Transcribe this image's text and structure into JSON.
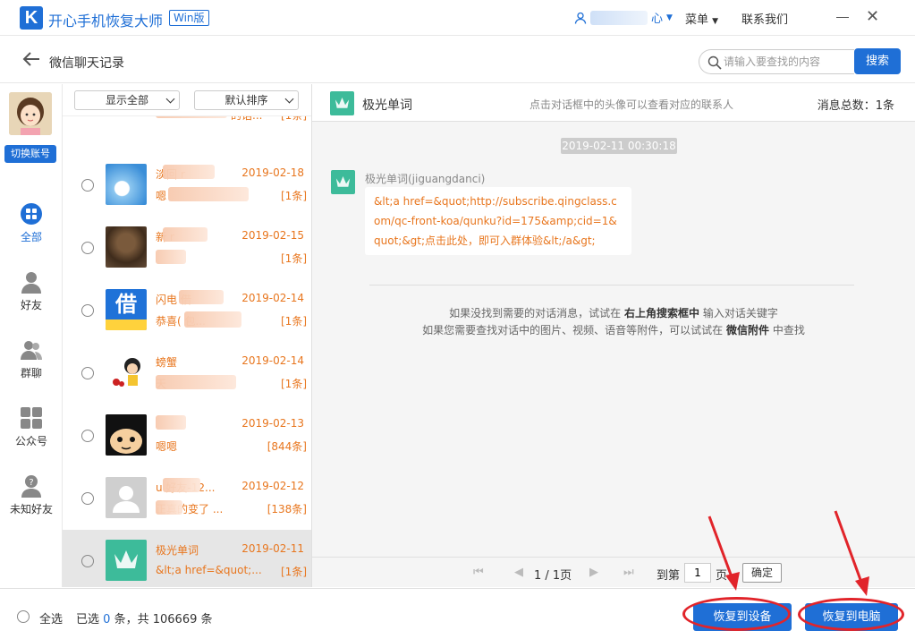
{
  "app": {
    "logo_letter": "K",
    "title": "开心手机恢复大师",
    "edition_badge": "Win版",
    "user_suffix": "心",
    "menu_label": "菜单",
    "contact_label": "联系我们"
  },
  "header": {
    "page_title": "微信聊天记录",
    "search_placeholder": "请输入要查找的内容",
    "search_button": "搜索"
  },
  "leftnav": {
    "switch_account": "切换账号",
    "items": [
      {
        "label": "全部",
        "icon": "grid-icon",
        "active": true
      },
      {
        "label": "好友",
        "icon": "person-icon",
        "active": false
      },
      {
        "label": "群聊",
        "icon": "group-icon",
        "active": false
      },
      {
        "label": "公众号",
        "icon": "squares-icon",
        "active": false
      },
      {
        "label": "未知好友",
        "icon": "unknown-person-icon",
        "active": false
      }
    ]
  },
  "list": {
    "filter_show": "显示全部",
    "filter_sort": "默认排序",
    "rows": [
      {
        "name": "",
        "preview": "的话...",
        "date": "",
        "count": "[1条]"
      },
      {
        "name": "淡回        r",
        "preview": "嗯",
        "date": "2019-02-18",
        "count": "[1条]"
      },
      {
        "name": "新        r",
        "preview": "",
        "date": "2019-02-15",
        "count": "[1条]"
      },
      {
        "name": "闪电         借",
        "preview": "恭喜(          包...",
        "date": "2019-02-14",
        "count": "[1条]"
      },
      {
        "name": "螃蟹",
        "preview": "              天",
        "date": "2019-02-14",
        "count": "[1条]"
      },
      {
        "name": "",
        "preview": "嗯嗯",
        "date": "2019-02-13",
        "count": "[844条]"
      },
      {
        "name": "u        好友-12...",
        "preview": "         正真的变了   ...",
        "date": "2019-02-12",
        "count": "[138条]"
      },
      {
        "name": "极光单词",
        "preview": "&lt;a href=&quot;...",
        "date": "2019-02-11",
        "count": "[1条]"
      }
    ]
  },
  "chat": {
    "contact_name": "极光单词",
    "hint": "点击对话框中的头像可以查看对应的联系人",
    "total_label": "消息总数：1条",
    "time": "2019-02-11 00:30:18",
    "sender": "极光单词(jiguangdanci)",
    "message": "&lt;a href=&quot;http://subscribe.qingclass.com/qc-front-koa/qunku?id=175&amp;cid=1&quot;&gt;点击此处，即可入群体验&lt;/a&gt;",
    "tip1_pre": "如果没找到需要的对话消息，试试在",
    "tip1_bold": "右上角搜索框中",
    "tip1_post": "输入对话关键字",
    "tip2_pre": "如果您需要查找对话中的图片、视频、语音等附件，可以试试在",
    "tip2_bold": "微信附件",
    "tip2_post": "中查找"
  },
  "pager": {
    "page_text": "1 / 1页",
    "goto_label": "到第",
    "page_input": "1",
    "page_unit": "页",
    "confirm": "确定"
  },
  "bottom": {
    "select_all": "全选",
    "selected_pre": "已选",
    "selected_count": "0",
    "selected_mid": "条，共",
    "total_count": "106669",
    "selected_post": "条",
    "restore_device": "恢复到设备",
    "restore_pc": "恢复到电脑"
  },
  "colors": {
    "accent": "#1f6fd6",
    "highlight_text": "#e8761e",
    "annotation_red": "#e1242a"
  }
}
